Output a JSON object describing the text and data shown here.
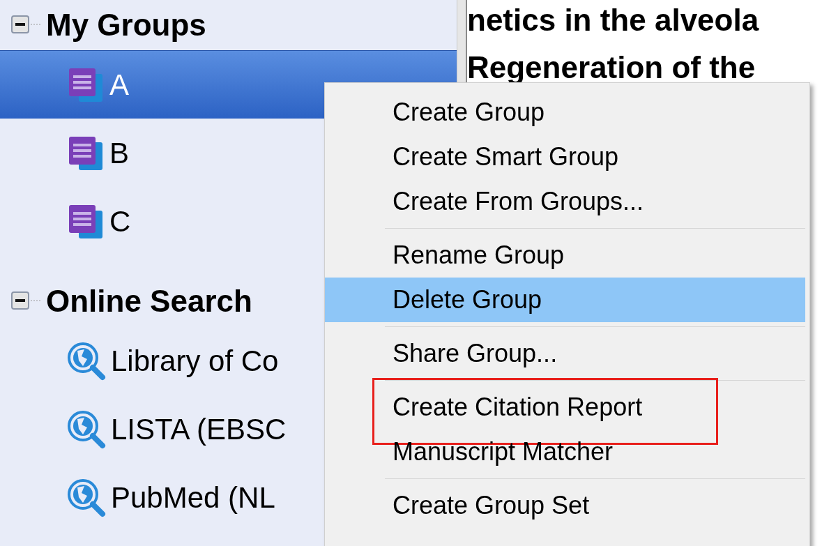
{
  "sidebar": {
    "sections": [
      {
        "title": "My Groups",
        "expanded": true,
        "items": [
          {
            "kind": "group",
            "label": "A",
            "selected": true
          },
          {
            "kind": "group",
            "label": "B",
            "selected": false
          },
          {
            "kind": "group",
            "label": "C",
            "selected": false
          }
        ]
      },
      {
        "title": "Online Search",
        "expanded": true,
        "items": [
          {
            "kind": "online",
            "label": "Library of Co",
            "selected": false
          },
          {
            "kind": "online",
            "label": "LISTA (EBSC",
            "selected": false
          },
          {
            "kind": "online",
            "label": "PubMed (NL",
            "selected": false
          }
        ]
      }
    ]
  },
  "document": {
    "lines": [
      "netics in the alveola",
      "Regeneration of the"
    ]
  },
  "context_menu": {
    "items": [
      {
        "kind": "item",
        "label": "Create Group",
        "selected": false
      },
      {
        "kind": "item",
        "label": "Create Smart Group",
        "selected": false
      },
      {
        "kind": "item",
        "label": "Create From Groups...",
        "selected": false
      },
      {
        "kind": "separator"
      },
      {
        "kind": "item",
        "label": "Rename Group",
        "selected": false
      },
      {
        "kind": "item",
        "label": "Delete Group",
        "selected": true
      },
      {
        "kind": "separator"
      },
      {
        "kind": "item",
        "label": "Share Group...",
        "selected": false
      },
      {
        "kind": "separator"
      },
      {
        "kind": "item",
        "label": "Create Citation Report",
        "selected": false,
        "annotated": true
      },
      {
        "kind": "item",
        "label": "Manuscript Matcher",
        "selected": false
      },
      {
        "kind": "separator"
      },
      {
        "kind": "item",
        "label": "Create Group Set",
        "selected": false
      }
    ]
  }
}
